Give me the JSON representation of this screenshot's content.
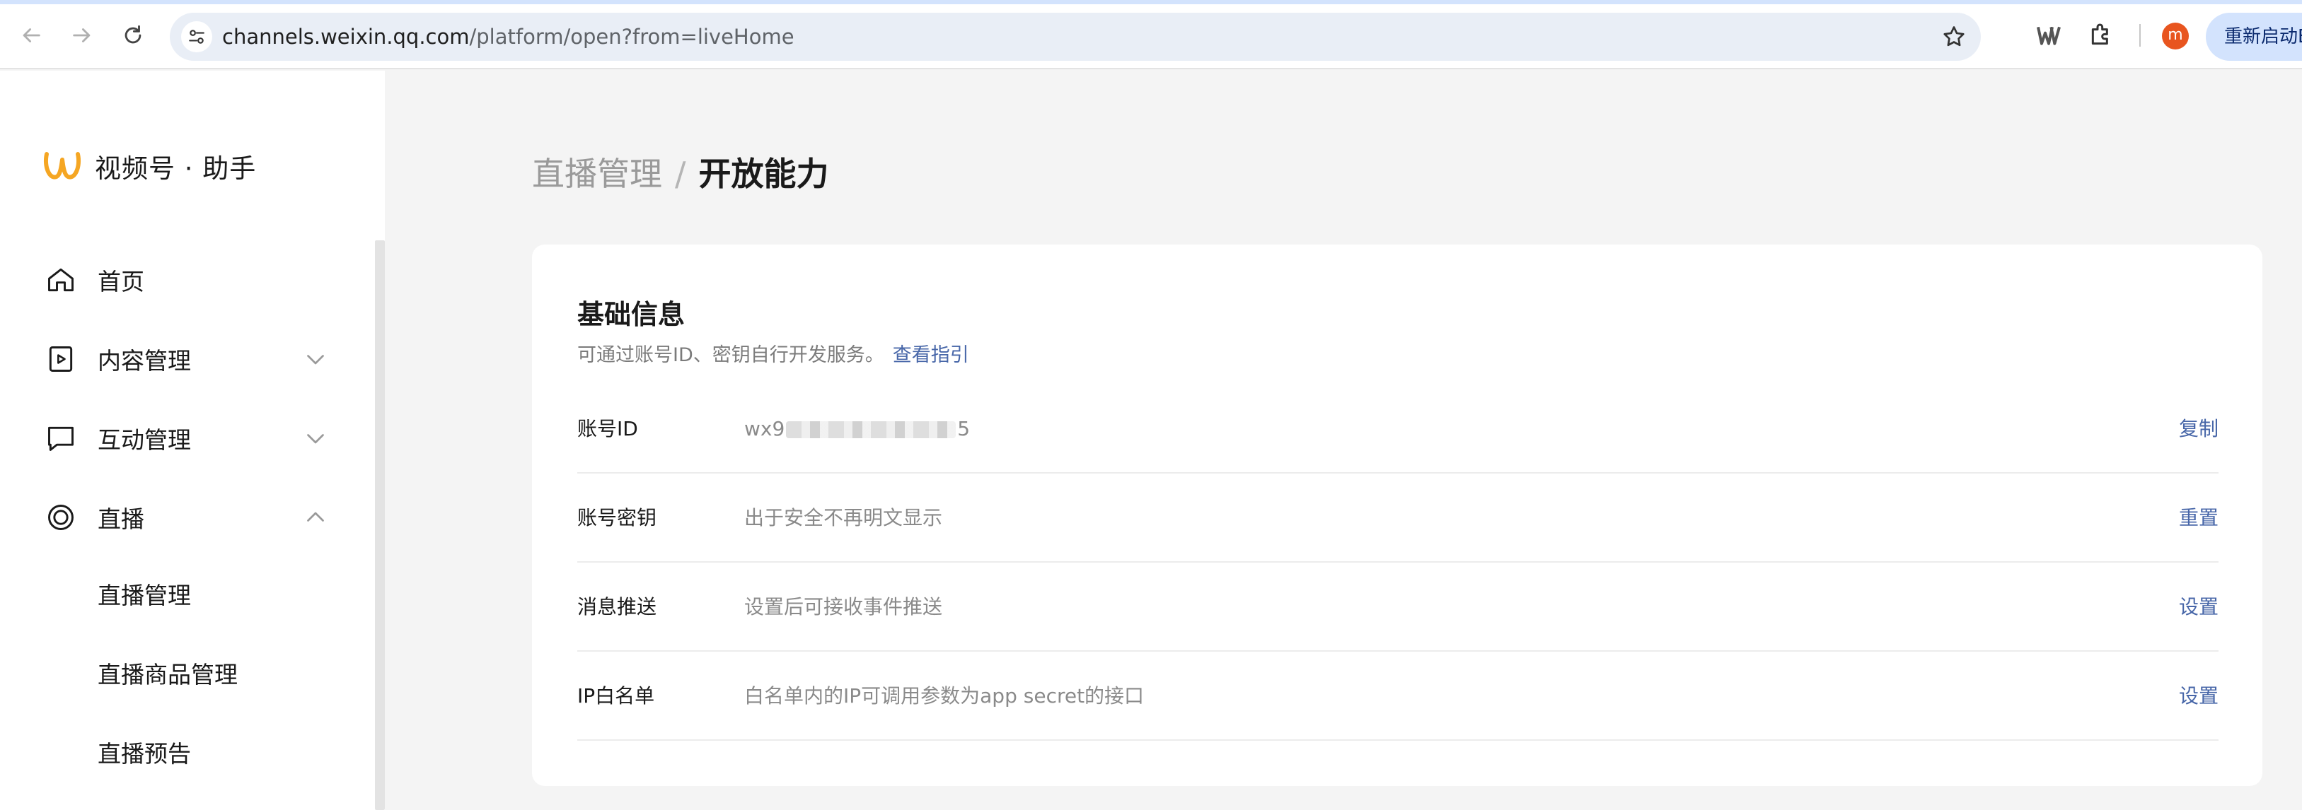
{
  "browser": {
    "url_host": "channels.weixin.qq.com",
    "url_path": "/platform/open?from=liveHome",
    "avatar_letter": "m",
    "restart_label": "重新启动E"
  },
  "sidebar": {
    "brand": "视频号 · 助手",
    "menu": [
      {
        "label": "首页",
        "icon": "home-icon"
      },
      {
        "label": "内容管理",
        "icon": "play-square-icon",
        "chevron": "down"
      },
      {
        "label": "互动管理",
        "icon": "chat-icon",
        "chevron": "down"
      },
      {
        "label": "直播",
        "icon": "live-ring-icon",
        "chevron": "up"
      }
    ],
    "live_sub": [
      "直播管理",
      "直播商品管理",
      "直播预告"
    ]
  },
  "breadcrumb": {
    "parent": "直播管理",
    "separator": "/",
    "current": "开放能力"
  },
  "basic_info": {
    "title": "基础信息",
    "description": "可通过账号ID、密钥自行开发服务。",
    "guide_link": "查看指引",
    "rows": [
      {
        "label": "账号ID",
        "value_prefix": "wx9",
        "value_suffix": "5",
        "action": "复制"
      },
      {
        "label": "账号密钥",
        "value": "出于安全不再明文显示",
        "action": "重置"
      },
      {
        "label": "消息推送",
        "value": "设置后可接收事件推送",
        "action": "设置"
      },
      {
        "label": "IP白名单",
        "value": "白名单内的IP可调用参数为app secret的接口",
        "action": "设置"
      }
    ]
  },
  "colors": {
    "link": "#4766a8",
    "brand_orange": "#f5a623",
    "avatar_bg": "#e8551f"
  }
}
